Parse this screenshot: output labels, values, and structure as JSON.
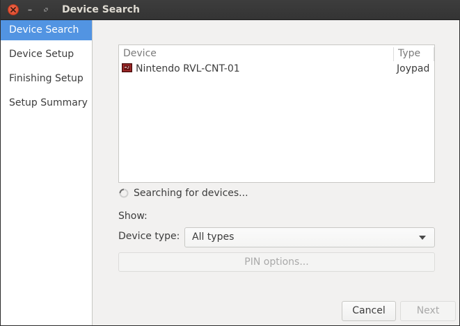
{
  "window": {
    "title": "Device Search"
  },
  "sidebar": {
    "items": [
      {
        "label": "Device Search",
        "active": true
      },
      {
        "label": "Device Setup",
        "active": false
      },
      {
        "label": "Finishing Setup",
        "active": false
      },
      {
        "label": "Setup Summary",
        "active": false
      }
    ]
  },
  "device_list": {
    "columns": [
      "Device",
      "Type"
    ],
    "rows": [
      {
        "icon": "joypad-device-icon",
        "name": "Nintendo RVL-CNT-01",
        "type": "Joypad"
      }
    ]
  },
  "status": {
    "text": "Searching for devices..."
  },
  "filter": {
    "show_label": "Show:",
    "device_type_label": "Device type:",
    "device_type_value": "All types"
  },
  "buttons": {
    "pin_options": "PIN options...",
    "cancel": "Cancel",
    "next": "Next"
  },
  "colors": {
    "accent": "#5294e2",
    "titlebar": "#3a3a3a",
    "close": "#e05a3a"
  }
}
